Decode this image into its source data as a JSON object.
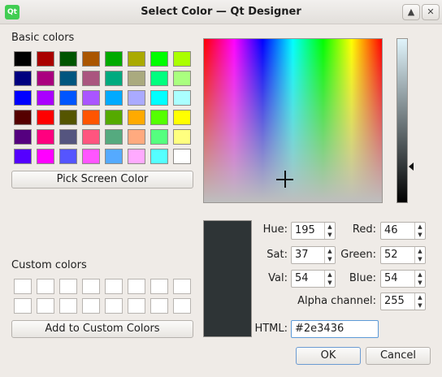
{
  "window": {
    "title": "Select Color — Qt Designer",
    "app_icon": "Qt"
  },
  "basic_colors": {
    "label": "Basic colors",
    "swatches": [
      [
        "#000000",
        "#aa0000",
        "#005500",
        "#aa5500",
        "#00aa00",
        "#aaaa00",
        "#00ff00",
        "#aaff00"
      ],
      [
        "#00007f",
        "#aa007f",
        "#00557f",
        "#aa557f",
        "#00aa7f",
        "#aaaa7f",
        "#00ff7f",
        "#aaff7f"
      ],
      [
        "#0000ff",
        "#aa00ff",
        "#0055ff",
        "#aa55ff",
        "#00aaff",
        "#aaaaff",
        "#00ffff",
        "#aaffff"
      ],
      [
        "#550000",
        "#ff0000",
        "#555500",
        "#ff5500",
        "#55aa00",
        "#ffaa00",
        "#55ff00",
        "#ffff00"
      ],
      [
        "#55007f",
        "#ff007f",
        "#55557f",
        "#ff557f",
        "#55aa7f",
        "#ffaa7f",
        "#55ff7f",
        "#ffff7f"
      ],
      [
        "#5500ff",
        "#ff00ff",
        "#5555ff",
        "#ff55ff",
        "#55aaff",
        "#ffaaff",
        "#55ffff",
        "#ffffff"
      ]
    ]
  },
  "pick_screen_color_label": "Pick Screen Color",
  "custom_colors": {
    "label": "Custom colors",
    "add_label": "Add to Custom Colors"
  },
  "fields": {
    "hue_label": "Hue:",
    "hue": "195",
    "sat_label": "Sat:",
    "sat": "37",
    "val_label": "Val:",
    "val": "54",
    "red_label": "Red:",
    "red": "46",
    "green_label": "Green:",
    "green": "52",
    "blue_label": "Blue:",
    "blue": "54",
    "alpha_label": "Alpha channel:",
    "alpha": "255",
    "html_label": "HTML:",
    "html": "#2e3436"
  },
  "current_color": "#2e3436",
  "buttons": {
    "ok": "OK",
    "cancel": "Cancel"
  }
}
